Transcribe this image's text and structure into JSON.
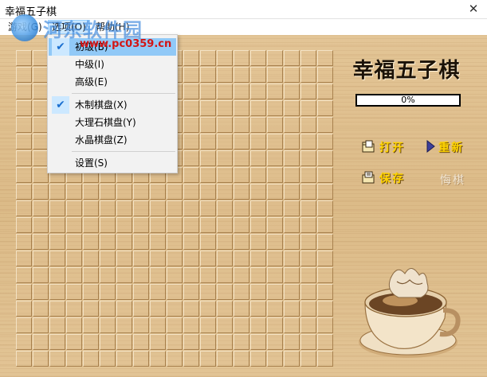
{
  "window": {
    "title": "幸福五子棋",
    "close_glyph": "✕"
  },
  "menubar": {
    "items": [
      "游戏(G)",
      "选项(O)",
      "帮助(H)"
    ]
  },
  "options_menu": {
    "items": [
      {
        "label": "初级(B)",
        "checked": true
      },
      {
        "label": "中级(I)",
        "checked": false
      },
      {
        "label": "高级(E)",
        "checked": false
      },
      {
        "label": "木制棋盘(X)",
        "checked": true
      },
      {
        "label": "大理石棋盘(Y)",
        "checked": false
      },
      {
        "label": "水晶棋盘(Z)",
        "checked": false
      },
      {
        "label": "设置(S)",
        "checked": false
      }
    ],
    "check_glyph": "✔"
  },
  "side_panel": {
    "game_title": "幸福五子棋",
    "progress": {
      "label": "0%",
      "value": 0
    },
    "buttons": {
      "open": {
        "label": "打开",
        "icon": "open-folder-icon"
      },
      "restart": {
        "label": "重新",
        "icon": "play-arrow-icon"
      },
      "save": {
        "label": "保存",
        "icon": "save-folder-icon"
      },
      "undo": {
        "label": "悔棋",
        "enabled": false
      }
    }
  },
  "board": {
    "size": 19
  },
  "watermark": {
    "text": "河东软件园",
    "url": "www.pc0359.cn"
  },
  "colors": {
    "accent_yellow": "#ffd400",
    "menu_highlight": "#91c9f7",
    "wood": "#dcbb88"
  }
}
